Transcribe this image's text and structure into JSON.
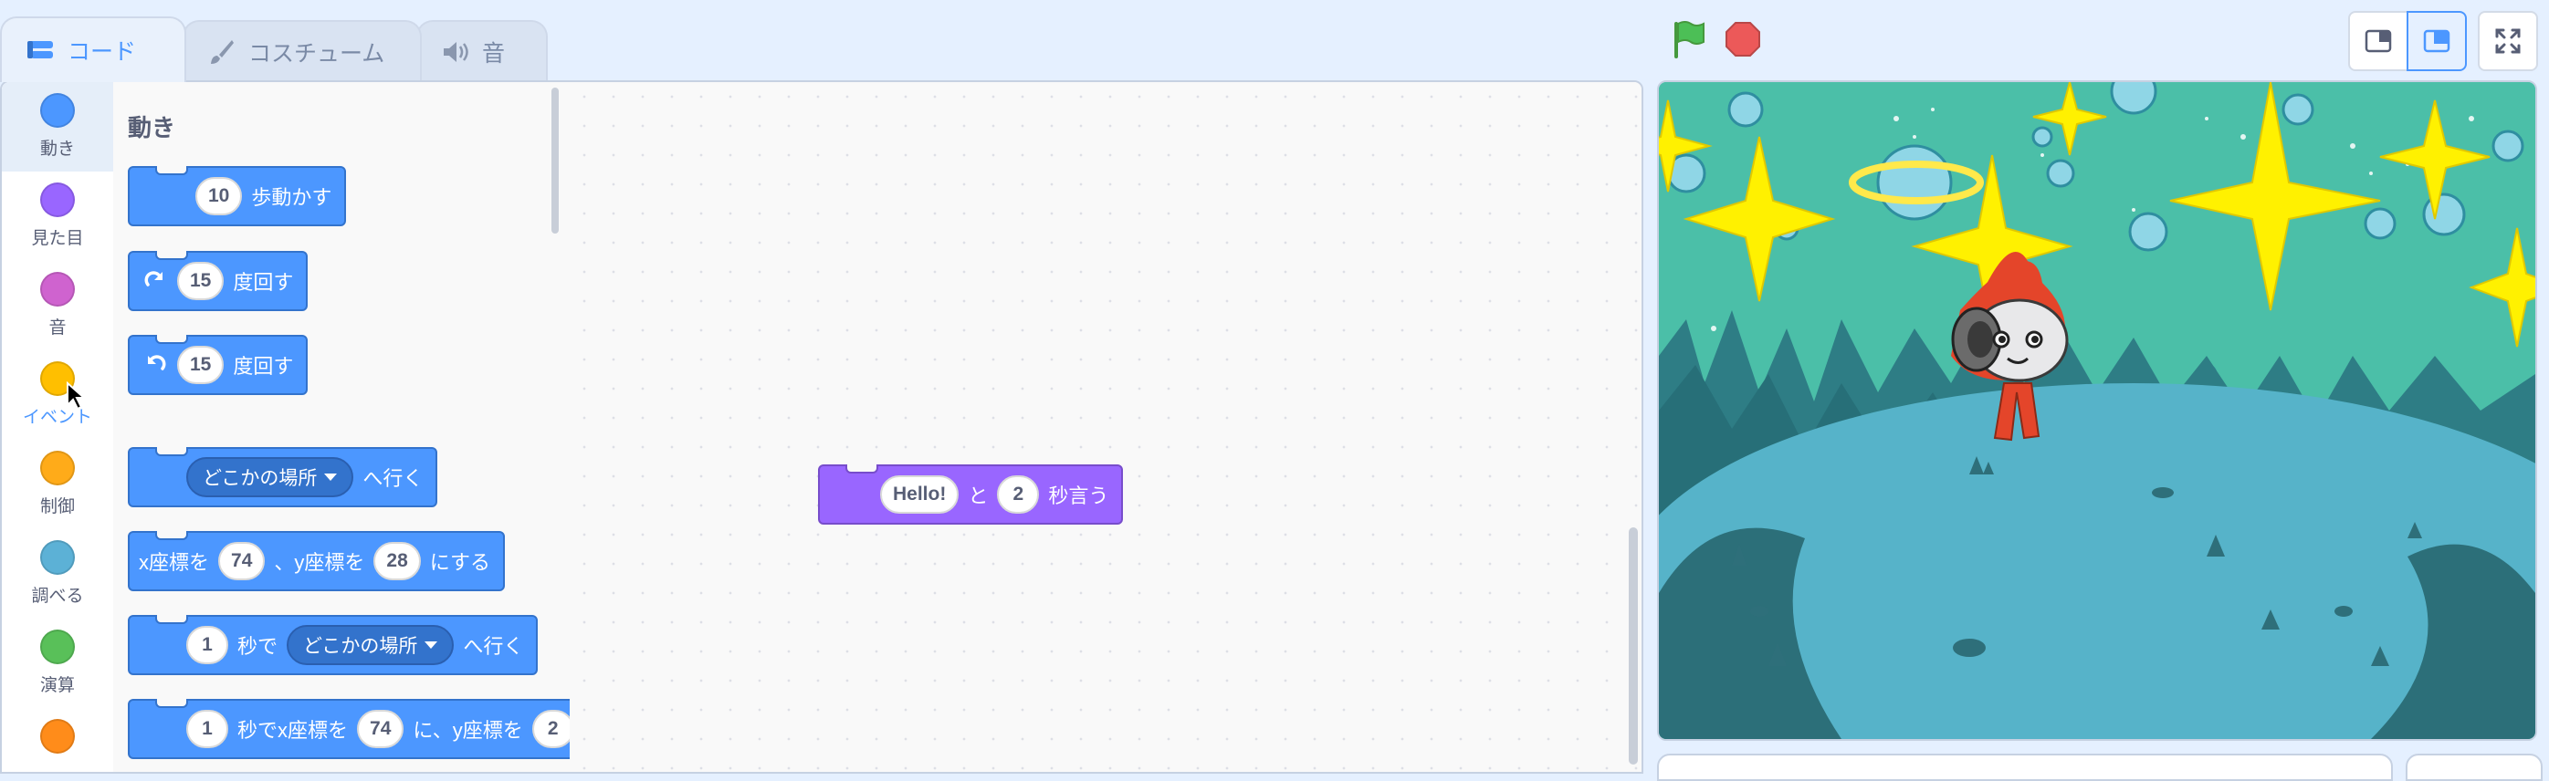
{
  "tabs": [
    {
      "label": "コード",
      "icon": "code-icon",
      "active": true
    },
    {
      "label": "コスチューム",
      "icon": "brush-icon",
      "active": false
    },
    {
      "label": "音",
      "icon": "speaker-icon",
      "active": false
    }
  ],
  "categories": [
    {
      "label": "動き",
      "color": "#4c97ff",
      "selected": true
    },
    {
      "label": "見た目",
      "color": "#9966ff"
    },
    {
      "label": "音",
      "color": "#cf63cf"
    },
    {
      "label": "イベント",
      "color": "#ffbf00"
    },
    {
      "label": "制御",
      "color": "#ffab19"
    },
    {
      "label": "調べる",
      "color": "#5cb1d6"
    },
    {
      "label": "演算",
      "color": "#59c059"
    },
    {
      "label": "",
      "color": "#ff8c1a"
    }
  ],
  "palette": {
    "title": "動き",
    "blocks": {
      "move": {
        "value": "10",
        "text": "歩動かす"
      },
      "turn_right": {
        "value": "15",
        "text": "度回す"
      },
      "turn_left": {
        "value": "15",
        "text": "度回す"
      },
      "goto": {
        "dropdown": "どこかの場所",
        "text": "へ行く"
      },
      "goto_xy": {
        "t1": "x座標を",
        "x": "74",
        "t2": "、y座標を",
        "y": "28",
        "t3": "にする"
      },
      "glide": {
        "value": "1",
        "t1": "秒で",
        "dropdown": "どこかの場所",
        "t2": "へ行く"
      },
      "glide_xy": {
        "value": "1",
        "t1": "秒でx座標を",
        "x": "74",
        "t2": "に、y座標を",
        "y": "2"
      }
    }
  },
  "script": {
    "say": {
      "message": "Hello!",
      "t1": "と",
      "secs": "2",
      "t2": "秒言う"
    }
  },
  "colors": {
    "motion": "#4c97ff",
    "looks": "#9966ff",
    "accent": "#4c97ff",
    "flag": "#45993d",
    "stop": "#ec5959"
  }
}
